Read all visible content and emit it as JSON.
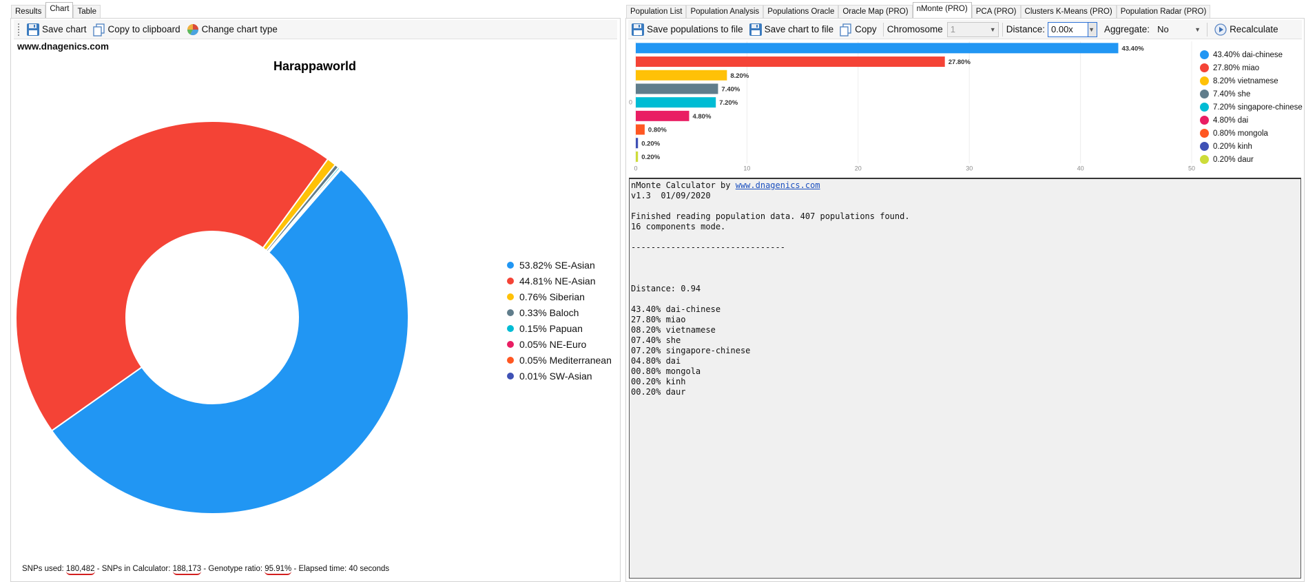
{
  "left_tabs": [
    {
      "label": "Results",
      "active": false
    },
    {
      "label": "Chart",
      "active": true
    },
    {
      "label": "Table",
      "active": false
    }
  ],
  "left_toolbar": {
    "save_chart": "Save chart",
    "copy_clipboard": "Copy to clipboard",
    "change_type": "Change chart type"
  },
  "watermark": "www.dnagenics.com",
  "chart_data": {
    "type": "pie",
    "donut": true,
    "title": "Harappaworld",
    "categories": [
      "SE-Asian",
      "NE-Asian",
      "Siberian",
      "Baloch",
      "Papuan",
      "NE-Euro",
      "Mediterranean",
      "SW-Asian"
    ],
    "values": [
      53.82,
      44.81,
      0.76,
      0.33,
      0.15,
      0.05,
      0.05,
      0.01
    ],
    "labels": [
      "53.82% SE-Asian",
      "44.81% NE-Asian",
      "0.76% Siberian",
      "0.33% Baloch",
      "0.15% Papuan",
      "0.05% NE-Euro",
      "0.05% Mediterranean",
      "0.01% SW-Asian"
    ],
    "colors": [
      "#2196f3",
      "#f44336",
      "#ffc107",
      "#607d8b",
      "#00bcd4",
      "#e91e63",
      "#ff5722",
      "#3f51b5"
    ],
    "legend_position": "right"
  },
  "status": {
    "snps_used_label": "SNPs used: ",
    "snps_used": "180,482",
    "snps_calc_label": " - SNPs in Calculator: ",
    "snps_calc": "188,173",
    "genotype_label": " - Genotype ratio: ",
    "genotype": "95.91%",
    "elapsed": " - Elapsed time: 40 seconds"
  },
  "right_tabs": [
    {
      "label": "Population List",
      "active": false
    },
    {
      "label": "Population Analysis",
      "active": false
    },
    {
      "label": "Populations Oracle",
      "active": false
    },
    {
      "label": "Oracle Map (PRO)",
      "active": false
    },
    {
      "label": "nMonte (PRO)",
      "active": true
    },
    {
      "label": "PCA (PRO)",
      "active": false
    },
    {
      "label": "Clusters K-Means (PRO)",
      "active": false
    },
    {
      "label": "Population Radar (PRO)",
      "active": false
    }
  ],
  "right_toolbar": {
    "save_populations": "Save populations to file",
    "save_chart_file": "Save chart to file",
    "copy": "Copy",
    "chromosome_label": "Chromosome",
    "chromosome_value": "1",
    "distance_label": "Distance:",
    "distance_value": "0.00x",
    "aggregate_label": "Aggregate:",
    "aggregate_value": "No",
    "recalculate": "Recalculate"
  },
  "bar_chart": {
    "type": "bar",
    "orientation": "horizontal",
    "categories": [
      "dai-chinese",
      "miao",
      "vietnamese",
      "she",
      "singapore-chinese",
      "dai",
      "mongola",
      "kinh",
      "daur"
    ],
    "values": [
      43.4,
      27.8,
      8.2,
      7.4,
      7.2,
      4.8,
      0.8,
      0.2,
      0.2
    ],
    "value_labels": [
      "43.40%",
      "27.80%",
      "8.20%",
      "7.40%",
      "7.20%",
      "4.80%",
      "0.80%",
      "0.20%",
      "0.20%"
    ],
    "legend_labels": [
      "43.40% dai-chinese",
      "27.80% miao",
      "8.20% vietnamese",
      "7.40% she",
      "7.20% singapore-chinese",
      "4.80% dai",
      "0.80% mongola",
      "0.20% kinh",
      "0.20% daur"
    ],
    "colors": [
      "#2196f3",
      "#f44336",
      "#ffc107",
      "#607d8b",
      "#00bcd4",
      "#e91e63",
      "#ff5722",
      "#3f51b5",
      "#cddc39"
    ],
    "xlim": [
      0,
      50
    ],
    "x_ticks": [
      "0",
      "10",
      "20",
      "30",
      "40",
      "50"
    ],
    "y_label": "0",
    "legend_position": "right",
    "grid": true
  },
  "console": {
    "line1_prefix": "nMonte Calculator by ",
    "line1_link": "www.dnagenics.com",
    "lines": [
      "v1.3  01/09/2020",
      "",
      "Finished reading population data. 407 populations found.",
      "16 components mode.",
      "",
      "-------------------------------",
      "",
      "",
      "",
      "Distance: 0.94",
      "",
      "43.40% dai-chinese",
      "27.80% miao",
      "08.20% vietnamese",
      "07.40% she",
      "07.20% singapore-chinese",
      "04.80% dai",
      "00.80% mongola",
      "00.20% kinh",
      "00.20% daur"
    ]
  }
}
